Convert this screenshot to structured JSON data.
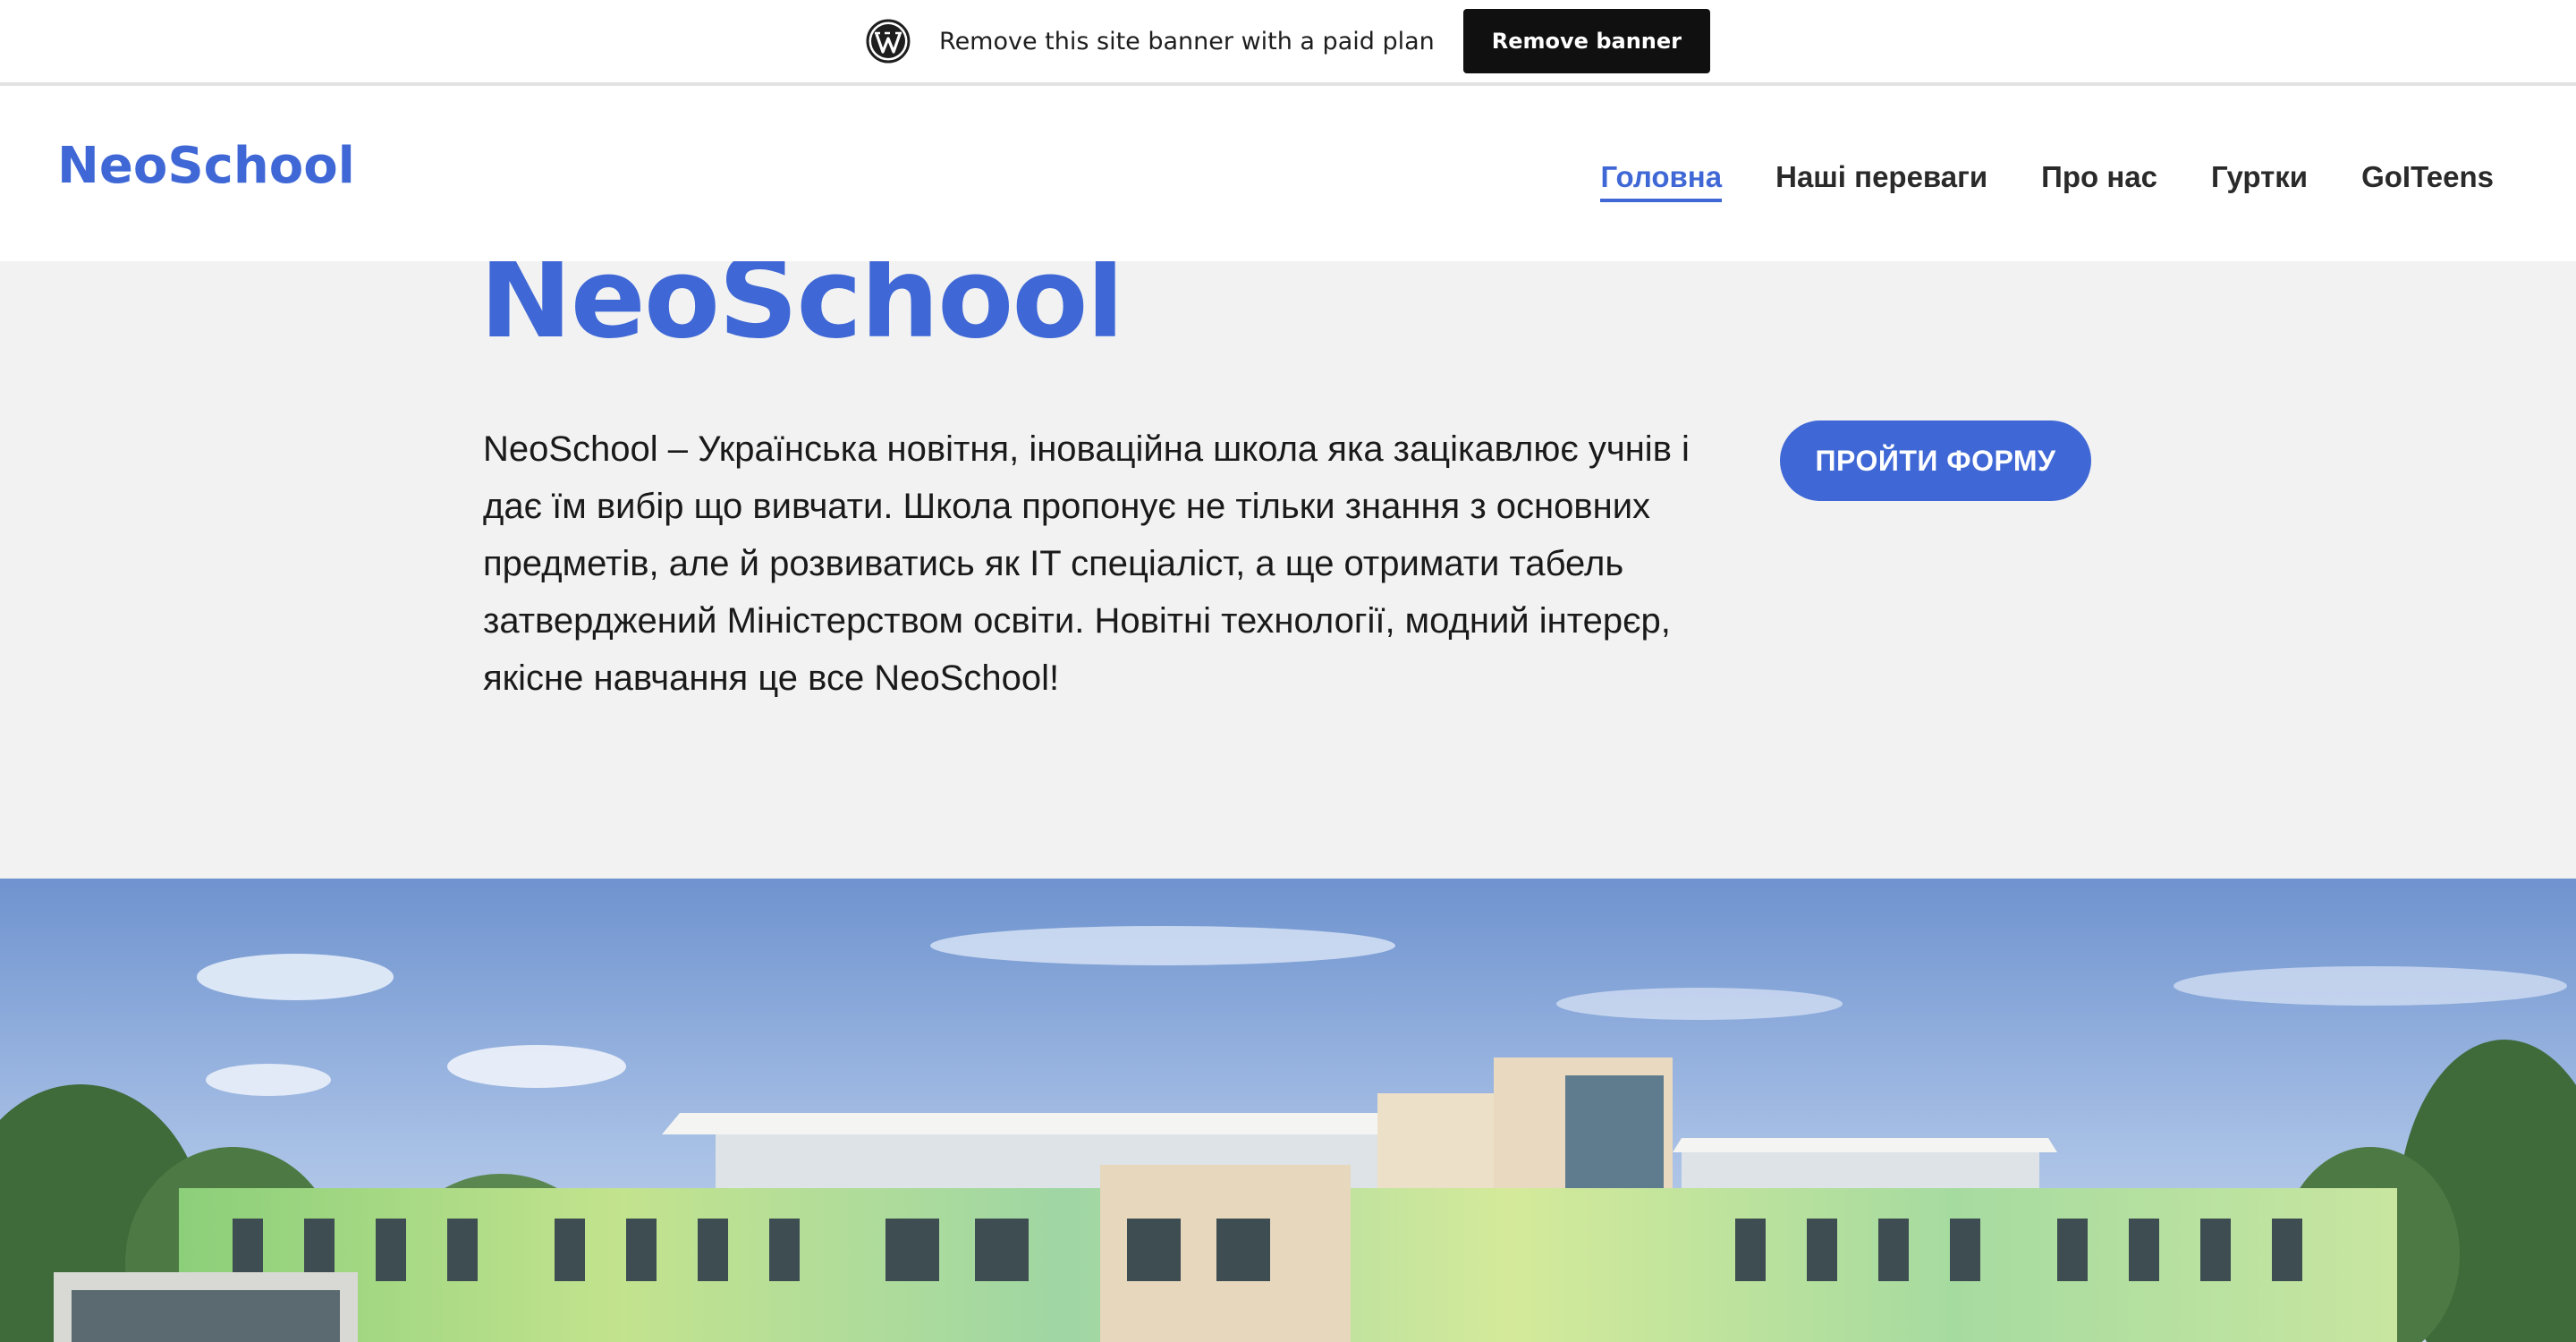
{
  "banner": {
    "icon": "wordpress-icon",
    "text": "Remove this site banner with a paid plan",
    "button_label": "Remove banner"
  },
  "header": {
    "site_title": "NeoSchool",
    "nav": [
      {
        "label": "Головна",
        "active": true
      },
      {
        "label": "Наші переваги",
        "active": false
      },
      {
        "label": "Про нас",
        "active": false
      },
      {
        "label": "Гуртки",
        "active": false
      },
      {
        "label": "GoITeens",
        "active": false
      }
    ]
  },
  "hero": {
    "title": "NeoSchool",
    "text": "NeoSchool – Українська новітня, іноваційна школа яка зацікавлює учнів і дає їм вибір що вивчати. Школа пропонує не тільки знання з основних предметів, але й розвиватись як IT спеціаліст, а ще отримати табель затверджений Міністерством освіти. Новітні технології, модний інтерєр, якісне навчання це все NeoSchool!",
    "cta_label": "ПРОЙТИ ФОРМУ"
  },
  "image": {
    "subject": "school-building-photo"
  },
  "colors": {
    "accent": "#3f68d6",
    "banner_button": "#101010",
    "hero_bg": "#f2f2f2",
    "text": "#1a1a1a"
  }
}
